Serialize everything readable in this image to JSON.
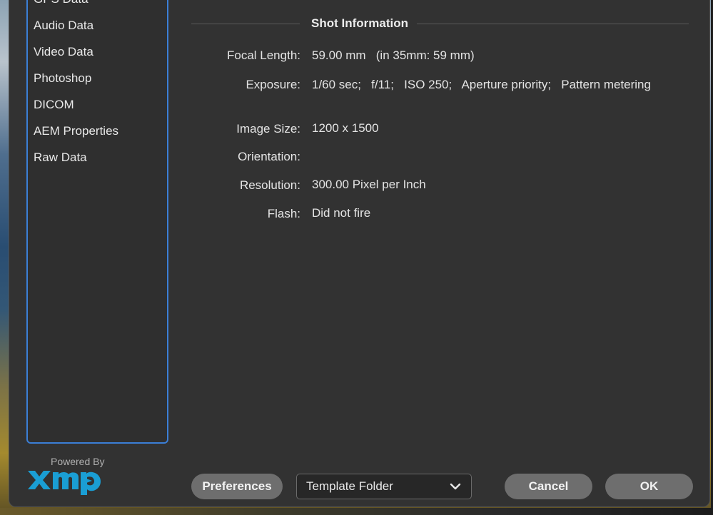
{
  "sidebar": {
    "items": [
      {
        "label": "GPS Data"
      },
      {
        "label": "Audio Data"
      },
      {
        "label": "Video Data"
      },
      {
        "label": "Photoshop"
      },
      {
        "label": "DICOM"
      },
      {
        "label": "AEM Properties"
      },
      {
        "label": "Raw Data"
      }
    ]
  },
  "branding": {
    "powered_by": "Powered By",
    "logo_text": "xmp",
    "logo_color": "#1a9ed4"
  },
  "section": {
    "title": "Shot Information",
    "fields": [
      {
        "label": "Focal Length:",
        "value": "59.00 mm   (in 35mm: 59 mm)"
      },
      {
        "label": "Exposure:",
        "value": "1/60 sec;   f/11;   ISO 250;   Aperture priority;   Pattern metering"
      },
      {
        "label": "Image Size:",
        "value": "1200 x 1500"
      },
      {
        "label": "Orientation:",
        "value": ""
      },
      {
        "label": "Resolution:",
        "value": "300.00 Pixel per Inch"
      },
      {
        "label": "Flash:",
        "value": "Did not fire"
      }
    ]
  },
  "footer": {
    "preferences_label": "Preferences",
    "template_dropdown": {
      "selected": "Template Folder"
    },
    "cancel_label": "Cancel",
    "ok_label": "OK"
  },
  "colors": {
    "accent": "#3b7fd6",
    "dialog_bg": "#323232",
    "button_bg": "#6e6e6e"
  }
}
